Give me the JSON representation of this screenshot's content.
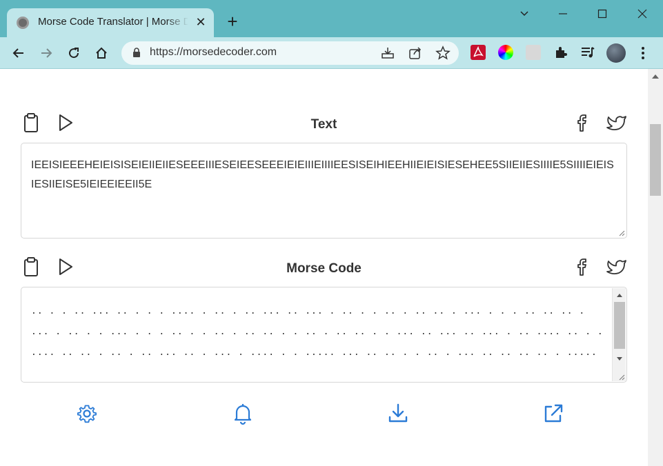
{
  "browser": {
    "tab_title": "Morse Code Translator | Morse Decoder",
    "tab_close": "✕",
    "new_tab": "+",
    "url": "https://morsedecoder.com"
  },
  "text_section": {
    "title": "Text",
    "value": "IEEISIEEEHEIEISISEIEIIEIIESEEEIIIESEIEESEEEIEIEIIIEIIIIEESISEIHIEEHIIEIEISIESEHEE5SIIEIIESIIIIE5SIIIIEIEISIESIIEISE5IEIEEIEEII5E"
  },
  "morse_section": {
    "title": "Morse Code",
    "value": "..   .  . .. ...   .. .   .   .        ....   . ..     . .. ...   ..   ...   .        .. .  . ..     . .. ..  . ... . .  .        ..    .. ..     . ...   .   .. .   .  ... .        . .   .. .   .    ..       . ..     .. . . .. .   ..   ..   . . ...  .. ...  ..  ... .   ..       ....       .. . . .... .. ..    .     ..    . .. ...   .. .     ...   .   ....   . . ..... ...   ..   ..     . . .. .   ...       .. ..      ..    .. . ..... ...        ..    .. .. .  .   .. .    .. ...    .. .     ...   ..   .. .    .. ...    . .....    .. .     .. . .   .. . .   ..   .. ..... ."
  },
  "colors": {
    "accent": "#2b7bd6",
    "frame": "#5fb7c0",
    "toolbar": "#bfe6ea"
  }
}
